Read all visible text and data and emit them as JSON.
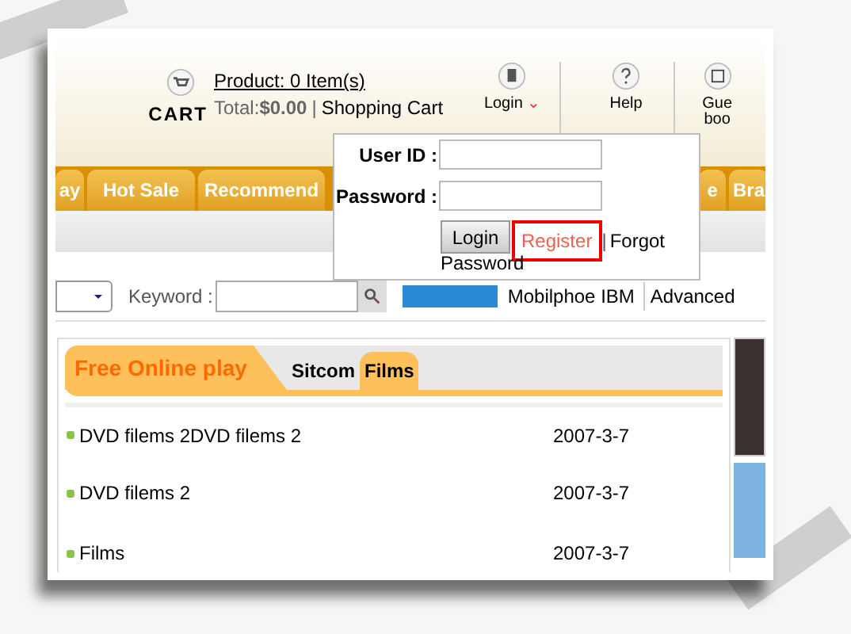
{
  "header": {
    "cart": {
      "label": "CART",
      "product_link": "Product: 0 Item(s)",
      "total_label": "Total:",
      "total_value": "$0.00",
      "separator": "|",
      "cart_link": "Shopping Cart"
    },
    "tools": [
      {
        "kind": "login",
        "label": "Login",
        "caret": "⌄"
      },
      {
        "kind": "help",
        "label": "Help"
      },
      {
        "kind": "guestbook",
        "label": "Gue\nboo"
      }
    ]
  },
  "nav": {
    "tabs": [
      {
        "label": "ay"
      },
      {
        "label": "Hot Sale"
      },
      {
        "label": "Recommend"
      },
      {
        "label": "e"
      },
      {
        "label": "Bra"
      }
    ]
  },
  "search": {
    "keyword_label": "Keyword :",
    "hot_keywords": [
      "Mobilphoe IBM"
    ],
    "advanced": "Advanced"
  },
  "panel": {
    "title": "Free Online play",
    "tabs": [
      {
        "label": "Sitcom",
        "selected": false
      },
      {
        "label": "Films",
        "selected": true
      }
    ],
    "rows": [
      {
        "title": "DVD filems 2DVD filems 2",
        "date": "2007-3-7"
      },
      {
        "title": "DVD filems 2",
        "date": "2007-3-7"
      },
      {
        "title": "Films",
        "date": "2007-3-7"
      }
    ]
  },
  "login_popup": {
    "user_label": "User ID :",
    "password_label": "Password :",
    "login_button": "Login",
    "register_link": "Register",
    "register_highlighted": true,
    "separator": "|",
    "forgot_link_lines": [
      "Forgot",
      "Password"
    ]
  }
}
